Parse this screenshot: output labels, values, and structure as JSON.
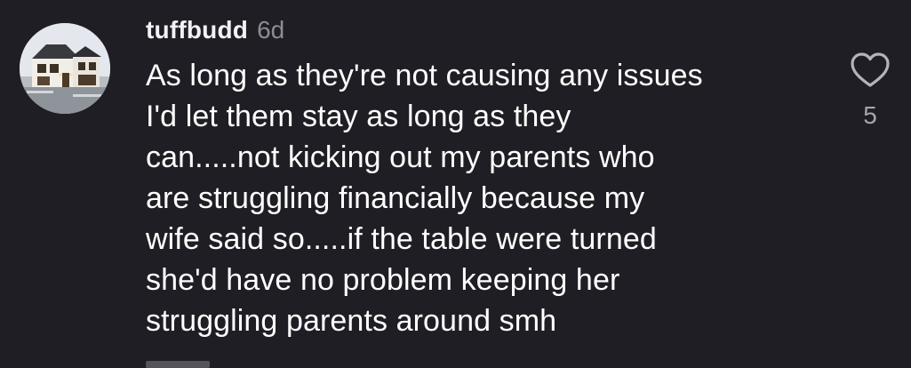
{
  "comment": {
    "username": "tuffbudd",
    "time": "6d",
    "text": "As long as they're not causing any issues\nI'd let them stay as long as they\ncan.....not kicking out my parents who\nare struggling financially because my\nwife said so.....if the table were turned\nshe'd have no problem keeping her\nstruggling parents around smh",
    "like_count": "5",
    "avatar_icon": "house-photo-avatar",
    "like_icon": "heart-outline-icon"
  },
  "colors": {
    "background": "#1f1e24",
    "username": "#f2f2f4",
    "time": "#8d8c95",
    "text": "#ffffff",
    "like": "#a6a5ad"
  }
}
